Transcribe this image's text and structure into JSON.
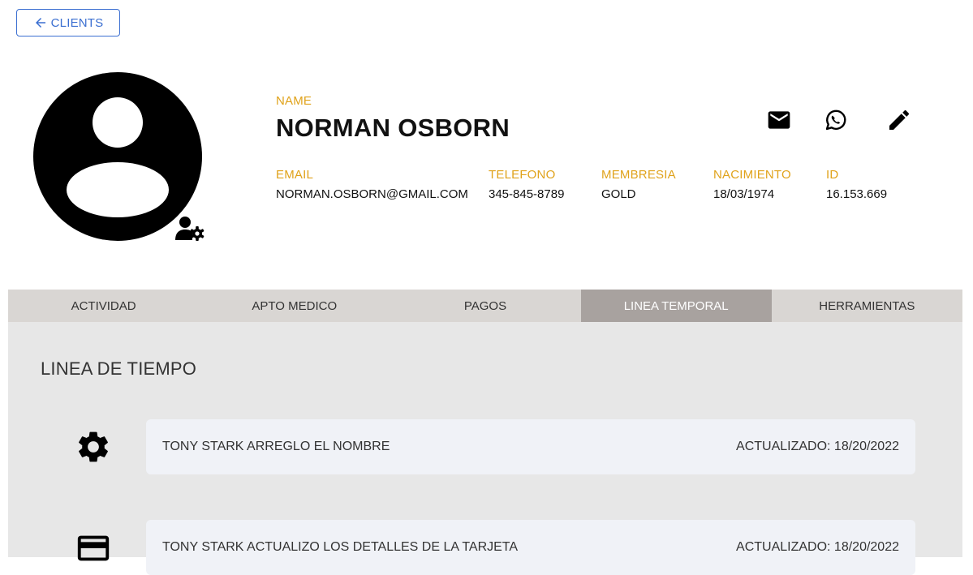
{
  "nav": {
    "back_label": "CLIENTS"
  },
  "profile": {
    "name_label": "NAME",
    "name": "NORMAN OSBORN",
    "fields": [
      {
        "label": "EMAIL",
        "value": "NORMAN.OSBORN@GMAIL.COM"
      },
      {
        "label": "TELEFONO",
        "value": "345-845-8789"
      },
      {
        "label": "MEMBRESIA",
        "value": "GOLD"
      },
      {
        "label": "NACIMIENTO",
        "value": "18/03/1974"
      },
      {
        "label": "ID",
        "value": "16.153.669"
      }
    ],
    "actions": [
      "email-icon",
      "whatsapp-icon",
      "edit-icon"
    ]
  },
  "tabs": [
    {
      "label": "ACTIVIDAD",
      "active": false
    },
    {
      "label": "APTO MEDICO",
      "active": false
    },
    {
      "label": "PAGOS",
      "active": false
    },
    {
      "label": "LINEA TEMPORAL",
      "active": true
    },
    {
      "label": "HERRAMIENTAS",
      "active": false
    }
  ],
  "timeline": {
    "title": "LINEA DE TIEMPO",
    "events": [
      {
        "icon": "gear-icon",
        "text": "TONY STARK ARREGLO EL NOMBRE",
        "date": "ACTUALIZADO: 18/20/2022"
      },
      {
        "icon": "credit-card-icon",
        "text": "TONY STARK ACTUALIZO LOS DETALLES DE LA TARJETA",
        "date": "ACTUALIZADO: 18/20/2022"
      }
    ]
  },
  "colors": {
    "accent": "#e0a21a",
    "link": "#3b6fd1",
    "tab_active": "#a8a29f",
    "tab_bar": "#d9d6d3"
  }
}
